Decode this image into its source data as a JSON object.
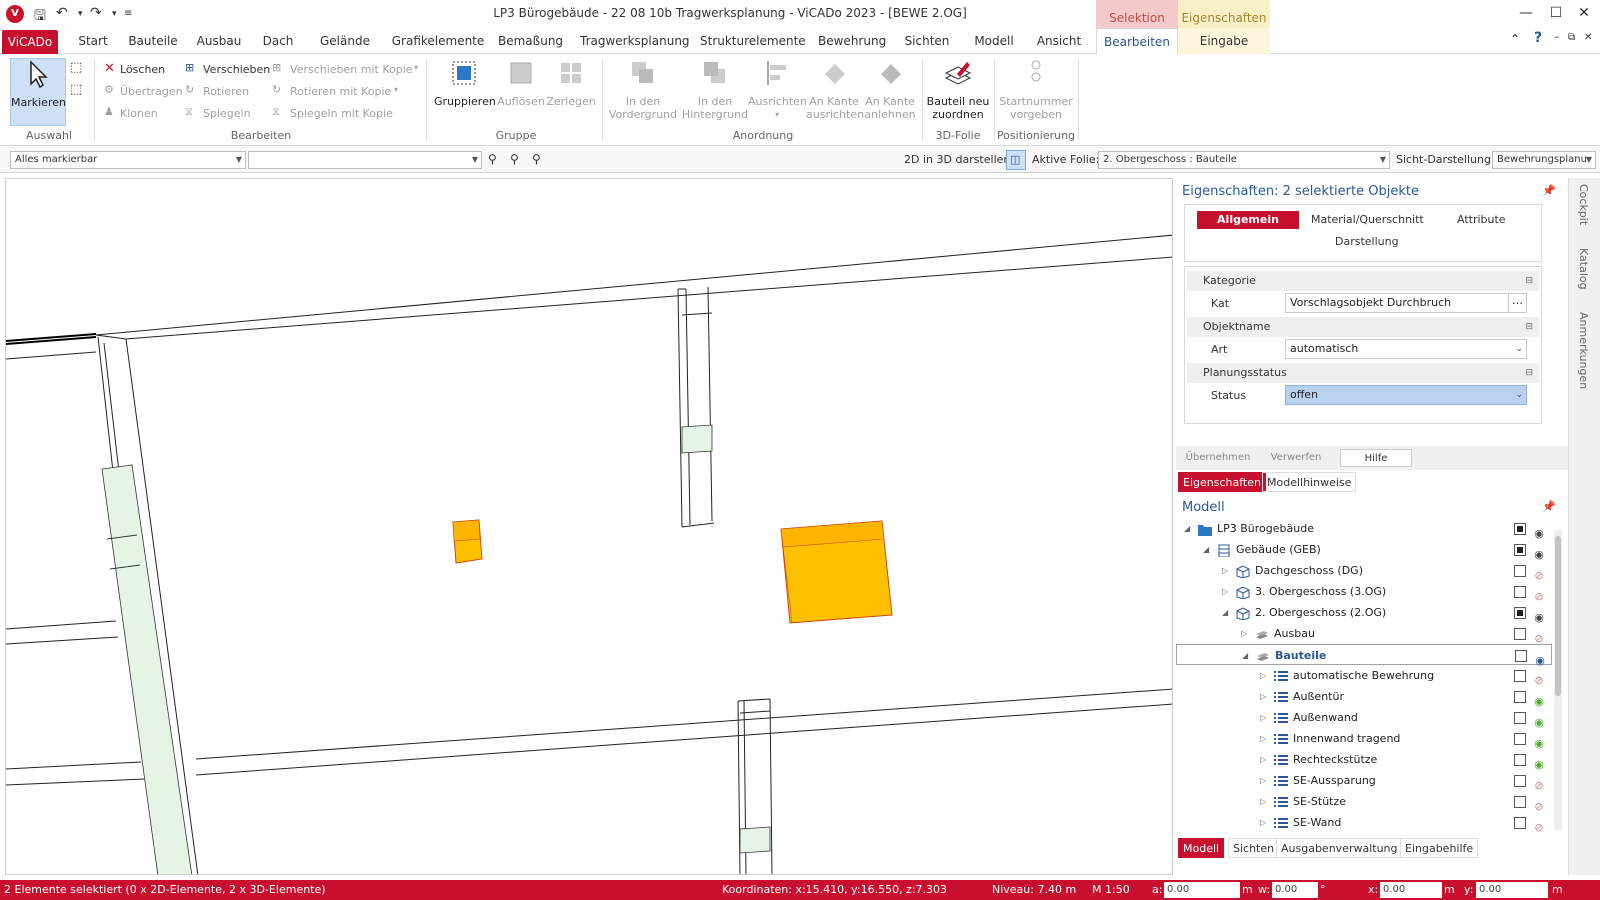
{
  "window": {
    "title": "LP3 Bürogebäude - 22 08 10b Tragwerksplanung - ViCADo 2023 - [BEWE 2.OG]",
    "ctx_selektion": "Selektion",
    "ctx_eigenschaften": "Eigenschaften",
    "app_icon": "V"
  },
  "tabs": [
    "ViCADo",
    "Start",
    "Bauteile",
    "Ausbau",
    "Dach",
    "Gelände",
    "Grafikelemente",
    "Bemaßung",
    "Tragwerksplanung",
    "Strukturelemente",
    "Bewehrung",
    "Sichten",
    "Modell",
    "Ansicht",
    "Bearbeiten",
    "Eingabe"
  ],
  "ribbon": {
    "markieren": "Markieren",
    "grp_auswahl": "Auswahl",
    "loeschen": "Löschen",
    "uebertragen": "Übertragen",
    "klonen": "Klonen",
    "verschieben": "Verschieben",
    "rotieren": "Rotieren",
    "spiegeln": "Spiegeln",
    "verschieben_kopie": "Verschieben mit Kopie",
    "rotieren_kopie": "Rotieren mit Kopie",
    "spiegeln_kopie": "Spiegeln mit Kopie",
    "grp_bearbeiten": "Bearbeiten",
    "gruppieren": "Gruppieren",
    "aufloesen": "Auflösen",
    "zerlegen": "Zerlegen",
    "grp_gruppe": "Gruppe",
    "vordergrund": "In den Vordergrund",
    "hintergrund": "In den Hintergrund",
    "ausrichten": "Ausrichten",
    "kante_ausrichten": "An Kante ausrichten",
    "kante_anlehnen": "An Kante anlehnen",
    "grp_anordnung": "Anordnung",
    "bauteil_neu": "Bauteil neu zuordnen",
    "grp_3dfolie": "3D-Folie",
    "startnummer": "Startnummer vorgeben",
    "grp_positionierung": "Positionierung"
  },
  "toolbar": {
    "filter": "Alles markierbar",
    "filter2": "",
    "label_2d3d": "2D in 3D darstellen:",
    "label_folie": "Aktive Folie:",
    "folie": "2. Obergeschoss : Bauteile",
    "label_sicht": "Sicht-Darstellung:",
    "sicht": "Bewehrungsplanu"
  },
  "properties": {
    "title": "Eigenschaften: 2 selektierte Objekte",
    "tabs": {
      "allgemein": "Allgemein",
      "material": "Material/Querschnitt",
      "attribute": "Attribute",
      "darstellung": "Darstellung"
    },
    "sections": [
      {
        "head": "Kategorie",
        "label": "Kat",
        "value": "Vorschlagsobjekt Durchbruch"
      },
      {
        "head": "Objektname",
        "label": "Art",
        "value": "automatisch"
      },
      {
        "head": "Planungsstatus",
        "label": "Status",
        "value": "offen"
      }
    ],
    "buttons": {
      "uebernehmen": "Übernehmen",
      "verwerfen": "Verwerfen",
      "hilfe": "Hilfe"
    },
    "subtabs": {
      "eigenschaften": "Eigenschaften",
      "modellhinweise": "Modellhinweise"
    }
  },
  "model": {
    "title": "Modell",
    "items": [
      {
        "label": "LP3 Bürogebäude",
        "level": 0,
        "checked": true,
        "eye": "dark",
        "expand": "open",
        "icon": "folder"
      },
      {
        "label": "Gebäude (GEB)",
        "level": 1,
        "checked": true,
        "eye": "dark",
        "expand": "open",
        "icon": "building"
      },
      {
        "label": "Dachgeschoss (DG)",
        "level": 2,
        "checked": false,
        "eye": "red",
        "expand": "closed",
        "icon": "floor"
      },
      {
        "label": "3. Obergeschoss (3.OG)",
        "level": 2,
        "checked": false,
        "eye": "red",
        "expand": "closed",
        "icon": "floor"
      },
      {
        "label": "2. Obergeschoss (2.OG)",
        "level": 2,
        "checked": true,
        "eye": "dark",
        "expand": "open",
        "icon": "floor"
      },
      {
        "label": "Ausbau",
        "level": 3,
        "checked": false,
        "eye": "red",
        "expand": "closed",
        "icon": "layer"
      },
      {
        "label": "Bauteile",
        "level": 3,
        "checked": false,
        "eye": "blue",
        "expand": "open",
        "icon": "layer",
        "selected": true
      },
      {
        "label": "automatische Bewehrung",
        "level": 4,
        "checked": false,
        "eye": "red",
        "expand": "closed",
        "icon": "list"
      },
      {
        "label": "Außentür",
        "level": 4,
        "checked": false,
        "eye": "green",
        "expand": "closed",
        "icon": "list"
      },
      {
        "label": "Außenwand",
        "level": 4,
        "checked": false,
        "eye": "green",
        "expand": "closed",
        "icon": "list"
      },
      {
        "label": "Innenwand tragend",
        "level": 4,
        "checked": false,
        "eye": "green",
        "expand": "closed",
        "icon": "list"
      },
      {
        "label": "Rechteckstütze",
        "level": 4,
        "checked": false,
        "eye": "green",
        "expand": "closed",
        "icon": "list"
      },
      {
        "label": "SE-Aussparung",
        "level": 4,
        "checked": false,
        "eye": "red",
        "expand": "closed",
        "icon": "list"
      },
      {
        "label": "SE-Stütze",
        "level": 4,
        "checked": false,
        "eye": "red",
        "expand": "closed",
        "icon": "list"
      },
      {
        "label": "SE-Wand",
        "level": 4,
        "checked": false,
        "eye": "red",
        "expand": "closed",
        "icon": "list"
      }
    ],
    "bottom_tabs": [
      "Modell",
      "Sichten",
      "Ausgabenverwaltung",
      "Eingabehilfe"
    ]
  },
  "sidebar": {
    "cockpit": "Cockpit",
    "katalog": "Katalog",
    "anmerkungen": "Anmerkungen"
  },
  "status": {
    "selection": "2 Elemente selektiert (0 x 2D-Elemente, 2 x 3D-Elemente)",
    "coords": "Koordinaten: x:15.410, y:16.550, z:7.303",
    "niveau": "Niveau: 7.40 m",
    "scale": "M 1:50",
    "a_label": "a:",
    "a_val": "0.00",
    "a_unit": "m",
    "w_label": "w:",
    "w_val": "0.00",
    "w_unit": "°",
    "x_label": "x:",
    "x_val": "0.00",
    "x_unit": "m",
    "y_label": "y:",
    "y_val": "0.00",
    "y_unit": "m"
  },
  "colors": {
    "accent": "#c8102e",
    "highlight": "#ffc000",
    "opening": "#e6f4e6",
    "link": "#2b5797"
  }
}
